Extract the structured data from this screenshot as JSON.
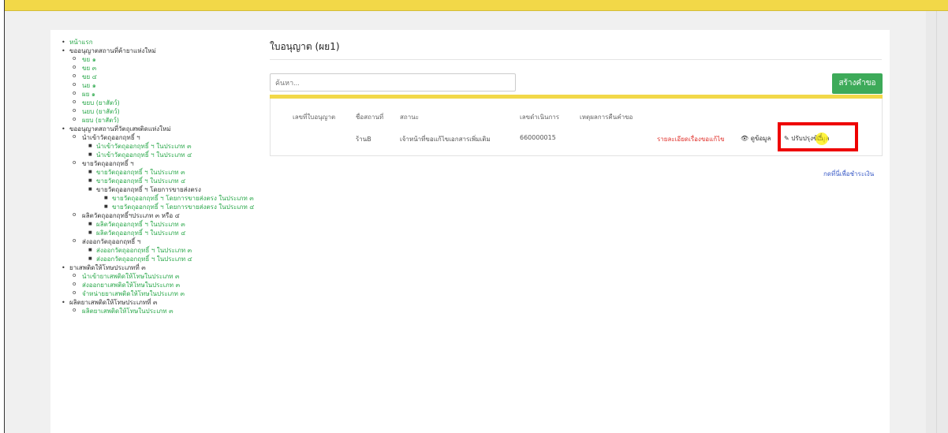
{
  "sidebar": {
    "items": [
      {
        "label": "หน้าแรก",
        "link": true
      },
      {
        "label": "ขออนุญาตสถานที่ค้ายาแห่งใหม่",
        "link": false,
        "children": [
          {
            "label": "ขย ๑",
            "link": true
          },
          {
            "label": "ขย ๓",
            "link": true
          },
          {
            "label": "ขย ๔",
            "link": true
          },
          {
            "label": "นย ๑",
            "link": true
          },
          {
            "label": "ผย ๑",
            "link": true
          },
          {
            "label": "ขยบ (ยาสัตว์)",
            "link": true
          },
          {
            "label": "นยบ (ยาสัตว์)",
            "link": true
          },
          {
            "label": "ผยบ (ยาสัตว์)",
            "link": true
          }
        ]
      },
      {
        "label": "ขออนุญาตสถานที่วัตถุเสพติดแห่งใหม่",
        "link": false,
        "children": [
          {
            "label": "นำเข้าวัตถุออกฤทธิ์ ฯ",
            "link": false,
            "children": [
              {
                "label": "นำเข้าวัตถุออกฤทธิ์ ฯ ในประเภท ๓"
              },
              {
                "label": "นำเข้าวัตถุออกฤทธิ์ ฯ ในประเภท ๔"
              }
            ]
          },
          {
            "label": "ขายวัตถุออกฤทธิ์ ฯ",
            "link": false,
            "children": [
              {
                "label": "ขายวัตถุออกฤทธิ์ ฯ ในประเภท ๓",
                "link": true
              },
              {
                "label": "ขายวัตถุออกฤทธิ์ ฯ ในประเภท ๔",
                "link": true
              },
              {
                "label": "ขายวัตถุออกฤทธิ์ ฯ โดยการขายส่งตรง",
                "link": false,
                "children": [
                  {
                    "label": "ขายวัตถุออกฤทธิ์ ฯ โดยการขายส่งตรง ในประเภท ๓"
                  },
                  {
                    "label": "ขายวัตถุออกฤทธิ์ ฯ โดยการขายส่งตรง ในประเภท ๔"
                  }
                ]
              }
            ]
          },
          {
            "label": "ผลิตวัตถุออกฤทธิ์ฯประเภท ๓ หรือ ๔",
            "link": false,
            "children": [
              {
                "label": "ผลิตวัตถุออกฤทธิ์ ฯ ในประเภท ๓"
              },
              {
                "label": "ผลิตวัตถุออกฤทธิ์ ฯ ในประเภท ๔"
              }
            ]
          },
          {
            "label": "ส่งออกวัตถุออกฤทธิ์ ฯ",
            "link": false,
            "children": [
              {
                "label": "ส่งออกวัตถุออกฤทธิ์ ฯ ในประเภท ๓"
              },
              {
                "label": "ส่งออกวัตถุออกฤทธิ์ ฯ ในประเภท ๔"
              }
            ]
          }
        ]
      },
      {
        "label": "ยาเสพติดให้โทษประเภทที่ ๓",
        "link": false,
        "children": [
          {
            "label": "นำเข้ายาเสพติดให้โทษในประเภท ๓",
            "link": true
          },
          {
            "label": "ส่งออกยาเสพติดให้โทษในประเภท ๓",
            "link": true
          },
          {
            "label": "จำหน่ายยาเสพติดให้โทษในประเภท ๓",
            "link": true
          }
        ]
      },
      {
        "label": "ผลิตยาเสพติดให้โทษประเภทที่ ๓",
        "link": false,
        "children": [
          {
            "label": "ผลิตยาเสพติดให้โทษในประเภท ๓",
            "link": true
          }
        ]
      }
    ]
  },
  "main": {
    "title": "ใบอนุญาต (ผย1)",
    "search_placeholder": "ค้นหา...",
    "create_label": "สร้างคำขอ",
    "table": {
      "headers": [
        "เลขที่ใบอนุญาต",
        "ชื่อสถานที่",
        "สถานะ",
        "เลขดำเนินการ",
        "เหตุผลการคืนคำขอ"
      ],
      "row": {
        "license_no": "",
        "place_name": "ร้านB",
        "status": "เจ้าหน้าที่ขอแก้ไขเอกสารเพิ่มเติม",
        "process_no": "660000015",
        "return_reason": "",
        "detail_link": "รายละเอียดเรื่องขอแก้ไข",
        "view_label": "ดูข้อมูล",
        "edit_label": "ปรับปรุงข้อมูล"
      }
    },
    "pay_link": "กดที่นี่เพื่อชำระเงิน"
  },
  "icons": {
    "view": "eye-icon",
    "edit": "pencil-icon",
    "cursor": "hand-pointer-icon"
  },
  "colors": {
    "accent_yellow": "#f2d848",
    "green": "#3daa59",
    "red": "#e0302a",
    "highlight": "#ee0000"
  }
}
